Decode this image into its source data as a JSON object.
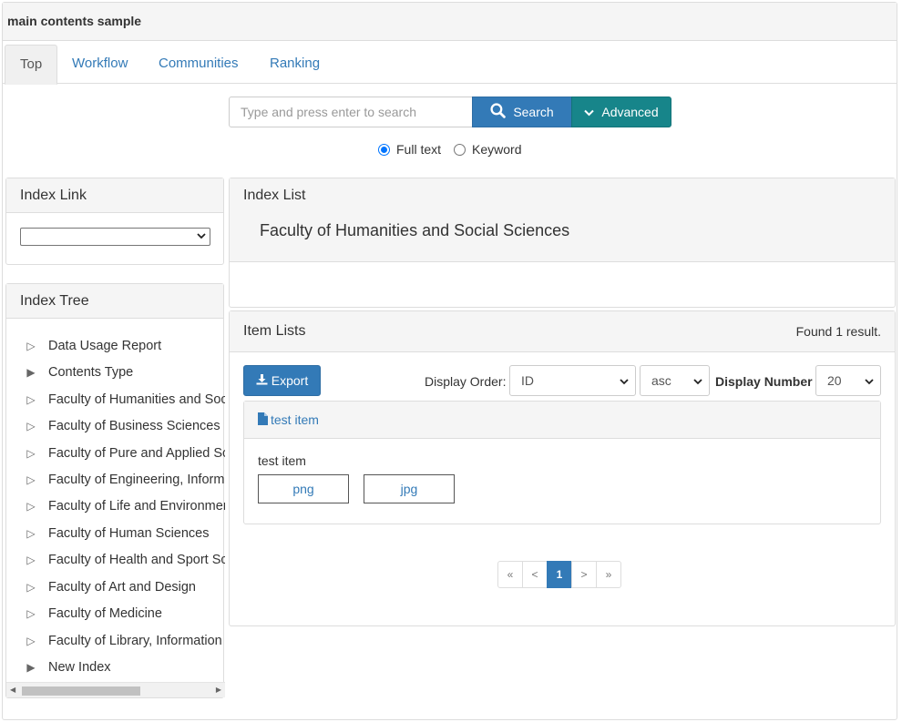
{
  "page": {
    "title": "main contents sample"
  },
  "tabs": [
    {
      "label": "Top",
      "active": true
    },
    {
      "label": "Workflow"
    },
    {
      "label": "Communities"
    },
    {
      "label": "Ranking"
    }
  ],
  "search": {
    "placeholder": "Type and press enter to search",
    "value": "",
    "search_label": "Search",
    "advanced_label": "Advanced",
    "options": [
      {
        "label": "Full text",
        "checked": true
      },
      {
        "label": "Keyword",
        "checked": false
      }
    ]
  },
  "index_link": {
    "title": "Index Link",
    "selected": ""
  },
  "index_tree": {
    "title": "Index Tree",
    "items": [
      {
        "label": "Data Usage Report",
        "expanded": false,
        "filled": false
      },
      {
        "label": "Contents Type",
        "filled": true
      },
      {
        "label": "Faculty of Humanities and Social Sciences",
        "filled": false
      },
      {
        "label": "Faculty of Business Sciences",
        "filled": false
      },
      {
        "label": "Faculty of Pure and Applied Sciences",
        "filled": false
      },
      {
        "label": "Faculty of Engineering, Information and Systems",
        "filled": false
      },
      {
        "label": "Faculty of Life and Environmental Sciences",
        "filled": false
      },
      {
        "label": "Faculty of Human Sciences",
        "filled": false
      },
      {
        "label": "Faculty of Health and Sport Sciences",
        "filled": false
      },
      {
        "label": "Faculty of Art and Design",
        "filled": false
      },
      {
        "label": "Faculty of Medicine",
        "filled": false
      },
      {
        "label": "Faculty of Library, Information and Media Science",
        "filled": false
      },
      {
        "label": "New Index",
        "filled": true
      }
    ]
  },
  "index_list": {
    "title": "Index List",
    "current": "Faculty of Humanities and Social Sciences"
  },
  "item_lists": {
    "title": "Item Lists",
    "result_text": "Found 1 result.",
    "export_label": "Export",
    "display_order_label": "Display Order:",
    "order_value": "ID",
    "direction_value": "asc",
    "display_number_label": "Display Number",
    "display_number_value": "20",
    "items": [
      {
        "title": "test item",
        "body": "test item",
        "files": [
          "png",
          "jpg"
        ]
      }
    ],
    "pagination": {
      "first": "«",
      "prev": "<",
      "current": "1",
      "next": ">",
      "last": "»"
    }
  },
  "icons": {
    "search": "search-icon",
    "advanced": "chevron-down-icon",
    "export": "download-icon",
    "item": "file-icon"
  },
  "colors": {
    "primary": "#337ab7",
    "advanced": "#17858a",
    "panel_head": "#f5f5f5"
  }
}
